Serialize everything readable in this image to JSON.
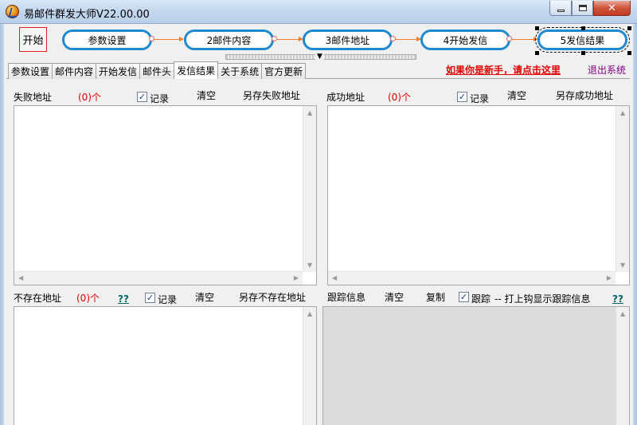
{
  "window": {
    "title": "易邮件群发大师V22.00.00"
  },
  "flow": {
    "start": "开始",
    "steps": [
      "参数设置",
      "2邮件内容",
      "3邮件地址",
      "4开始发信",
      "5发信结果"
    ]
  },
  "tabs": [
    "参数设置",
    "邮件内容",
    "开始发信",
    "邮件头",
    "发信结果",
    "关于系统",
    "官方更新"
  ],
  "links": {
    "newbie": "如果你是新手，请点击这里",
    "exit": "退出系统"
  },
  "failed": {
    "label": "失败地址",
    "count": "(0)个",
    "record": "记录",
    "record_checked": true,
    "clear": "清空",
    "save": "另存失败地址"
  },
  "success": {
    "label": "成功地址",
    "count": "(0)个",
    "record": "记录",
    "record_checked": true,
    "clear": "清空",
    "save": "另存成功地址"
  },
  "nonexist": {
    "label": "不存在地址",
    "count": "(0)个",
    "help": "??",
    "record": "记录",
    "record_checked": true,
    "clear": "清空",
    "save": "另存不存在地址"
  },
  "trace": {
    "label": "跟踪信息",
    "clear": "清空",
    "copy": "复制",
    "track": "跟踪",
    "track_checked": true,
    "hint": "-- 打上钩显示跟踪信息",
    "help": "??"
  }
}
